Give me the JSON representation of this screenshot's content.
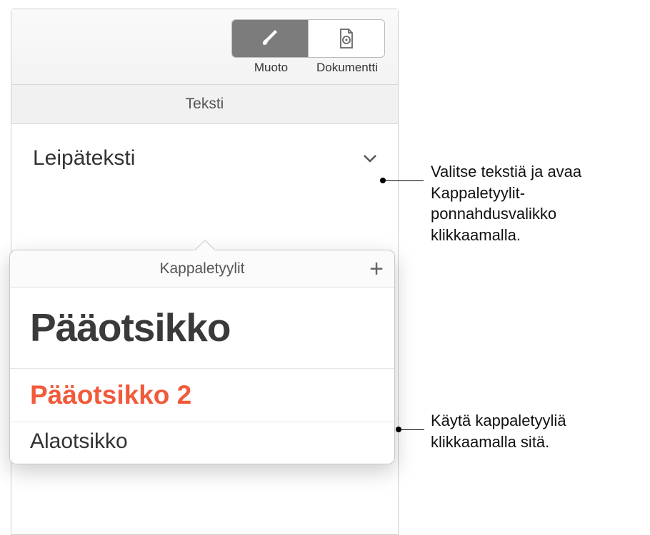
{
  "toolbar": {
    "format_label": "Muoto",
    "document_label": "Dokumentti"
  },
  "inspector": {
    "tab_label": "Teksti",
    "current_style": "Leipäteksti"
  },
  "popover": {
    "title": "Kappaletyylit",
    "styles": [
      {
        "label": "Pääotsikko"
      },
      {
        "label": "Pääotsikko 2"
      },
      {
        "label": "Alaotsikko"
      }
    ]
  },
  "callouts": {
    "top": "Valitse tekstiä ja avaa Kappaletyylit-ponnahdusvalikko klikkaamalla.",
    "bottom": "Käytä kappaletyyliä klikkaamalla sitä."
  }
}
